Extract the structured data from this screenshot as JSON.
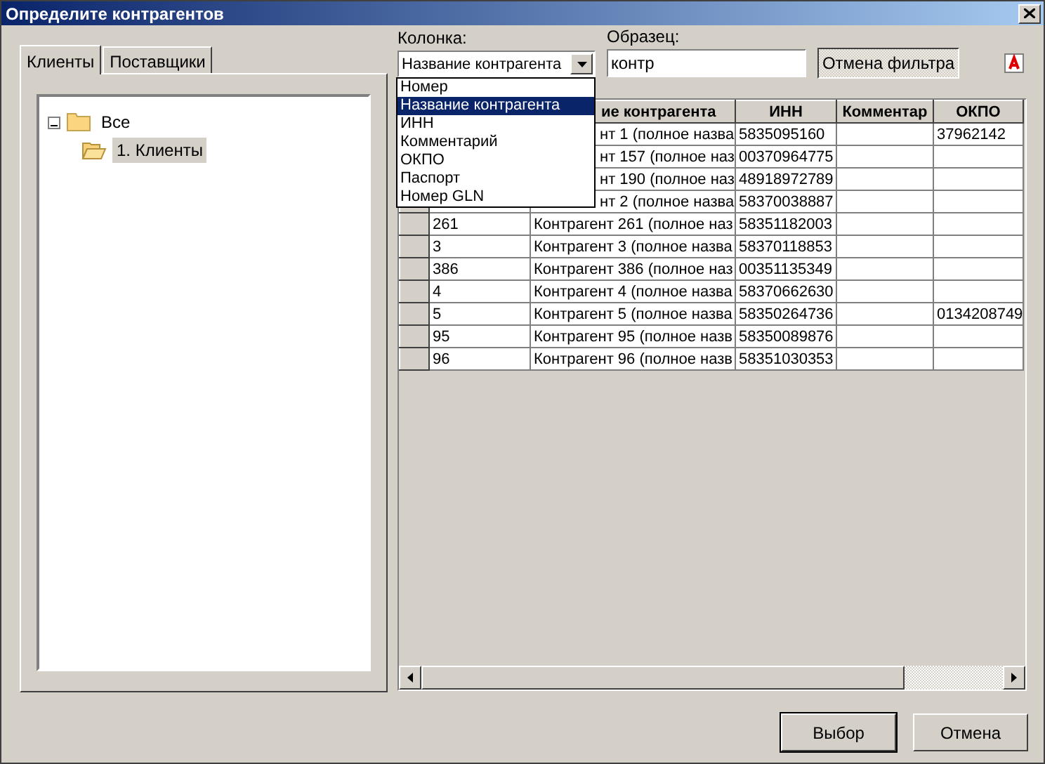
{
  "window": {
    "title": "Определите контрагентов"
  },
  "tabs": [
    {
      "label": "Клиенты",
      "selected": true
    },
    {
      "label": "Поставщики",
      "selected": false
    }
  ],
  "tree": [
    {
      "label": "Все",
      "expanded": true,
      "selected": false,
      "children": [
        {
          "label": "1. Клиенты",
          "selected": true
        }
      ]
    }
  ],
  "filter": {
    "column_label": "Колонка:",
    "column_value": "Название контрагента",
    "sample_label": "Образец:",
    "sample_value": "контр",
    "cancel_button": "Отмена фильтра",
    "column_options": [
      {
        "label": "Номер",
        "selected": false
      },
      {
        "label": "Название контрагента",
        "selected": true
      },
      {
        "label": "ИНН",
        "selected": false
      },
      {
        "label": "Комментарий",
        "selected": false
      },
      {
        "label": "ОКПО",
        "selected": false
      },
      {
        "label": "Паспорт",
        "selected": false
      },
      {
        "label": "Номер GLN",
        "selected": false
      }
    ]
  },
  "table": {
    "columns": [
      {},
      {
        "label": "ие контрагента",
        "partly_hidden": true
      },
      {
        "label": "ИНН"
      },
      {
        "label": "Комментар"
      },
      {
        "label": "ОКПО"
      }
    ],
    "rows": [
      {
        "name": "нт 1 (полное назва",
        "inn": "5835095160",
        "okpo": "37962142",
        "partly_hidden": true
      },
      {
        "name": "нт 157 (полное наз",
        "inn": "00370964775",
        "partly_hidden": true
      },
      {
        "name": "нт 190 (полное наз",
        "inn": "48918972789",
        "partly_hidden": true
      },
      {
        "name": "нт 2 (полное назва",
        "inn": "58370038887",
        "partly_hidden": true
      },
      {
        "number": "261",
        "name": "Контрагент 261 (полное наз",
        "inn": "58351182003",
        "partly_hidden": false
      },
      {
        "number": "3",
        "name": "Контрагент 3 (полное назва",
        "inn": "58370118853",
        "partly_hidden": false
      },
      {
        "number": "386",
        "name": "Контрагент 386 (полное наз",
        "inn": "00351135349",
        "partly_hidden": false
      },
      {
        "number": "4",
        "name": "Контрагент 4 (полное назва",
        "inn": "58370662630",
        "partly_hidden": false
      },
      {
        "number": "5",
        "name": "Контрагент 5 (полное назва",
        "inn": "58350264736",
        "okpo": "0134208749",
        "partly_hidden": false
      },
      {
        "number": "95",
        "name": "Контрагент 95 (полное назв",
        "inn": "58350089876",
        "partly_hidden": false
      },
      {
        "number": "96",
        "name": "Контрагент 96 (полное назв",
        "inn": "58351030353",
        "partly_hidden": false
      }
    ]
  },
  "buttons": [
    {
      "label": "Выбор",
      "default": true
    },
    {
      "label": "Отмена",
      "default": false
    }
  ]
}
